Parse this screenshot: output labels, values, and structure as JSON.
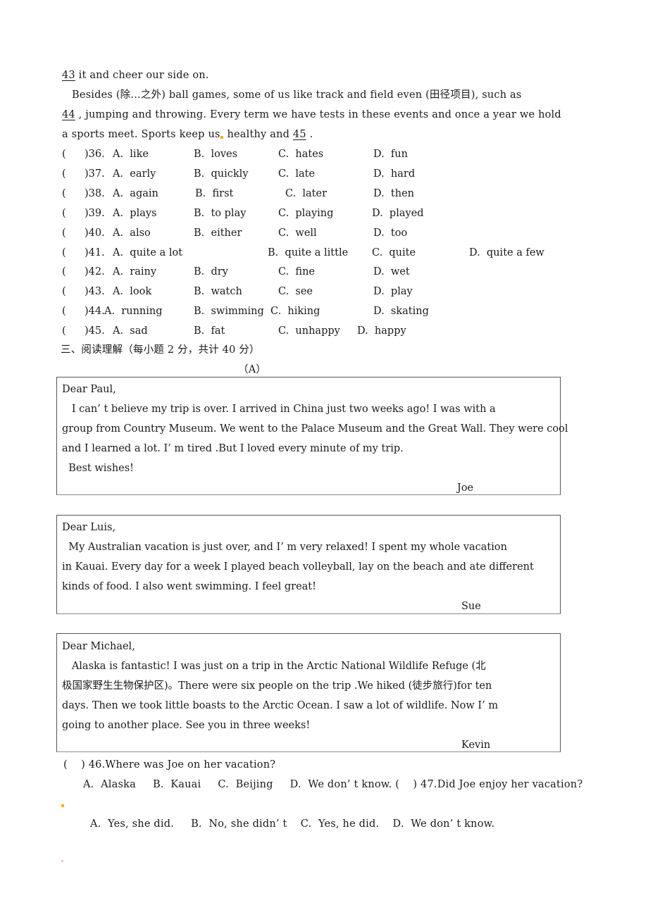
{
  "passage": {
    "line1": {
      "blank": "43",
      "text": " it and cheer our side on."
    },
    "line2": "Besides (除...之外) ball games, some of us like track and field even (田径项目), such as",
    "line3": {
      "blank": "44",
      "text": " , jumping and throwing. Every term we have tests in these events and once a year we hold"
    },
    "line4": {
      "before": "a sports meet. Sports keep us",
      "after": " healthy and ",
      "blank": "45",
      "end": " ."
    }
  },
  "cloze_questions": [
    {
      "num": ")36.",
      "A": "A.  like",
      "B": "B.  loves",
      "C": "C.  hates",
      "D": "D.  fun"
    },
    {
      "num": ")37.",
      "A": "A.  early",
      "B": "B.  quickly",
      "C": "C.  late",
      "D": "D.  hard"
    },
    {
      "num": ")38.",
      "A": "A.  again",
      "B": "B.  first",
      "C": "C.  later",
      "D": "D.  then"
    },
    {
      "num": ")39.",
      "A": "A.  plays",
      "B": "B.  to play",
      "C": "C.  playing",
      "D": "D.  played"
    },
    {
      "num": ")40.",
      "A": "A.  also",
      "B": "B.  either",
      "C": "C.  well",
      "D": "D.  too"
    },
    {
      "num": ")41.",
      "A": "A.  quite a lot",
      "B": "B.  quite a little",
      "C": "C.  quite",
      "D": "D.  quite a few"
    },
    {
      "num": ")42.",
      "A": "A.  rainy",
      "B": "B.  dry",
      "C": "C.  fine",
      "D": "D.  wet"
    },
    {
      "num": ")43.",
      "A": "A.  look",
      "B": "B.  watch",
      "C": "C.  see",
      "D": "D.  play"
    },
    {
      "num": ")44.",
      "A": "A.  running",
      "B": "B.  swimming",
      "C": "C.  hiking",
      "D": "D.  skating"
    },
    {
      "num": ")45.",
      "A": "A.  sad",
      "B": "B.  fat",
      "C": "C.  unhappy",
      "D": "D.  happy"
    }
  ],
  "paren_open": "(",
  "section_heading": "三、阅读理解（每小题 2 分，共计 40 分）",
  "passage_label": "（A）",
  "letters": [
    {
      "greeting": "Dear Paul,",
      "lines": [
        "   I can’ t believe my trip is over. I arrived in China just two weeks ago! I was with a",
        "group from Country Museum. We went to the Palace Museum and the Great Wall. They were cool",
        "and I learned a lot. I’ m tired .But I loved every minute of my trip.",
        "  Best wishes!"
      ],
      "signature": "Joe"
    },
    {
      "greeting": "Dear Luis,",
      "lines": [
        "  My Australian vacation is just over, and I’ m very relaxed! I spent my whole vacation",
        "in Kauai. Every day for a week I played beach volleyball, lay on the beach and ate different",
        "kinds of food. I also went swimming. I feel great!"
      ],
      "signature": "Sue"
    },
    {
      "greeting": "Dear Michael,",
      "lines": [
        "   Alaska is fantastic! I was just on a trip in the Arctic National Wildlife Refuge (北",
        "极国家野生生物保护区)。There were six people on the trip .We hiked (徒步旅行)for ten",
        "days. Then we took little boasts to the Arctic Ocean. I saw a lot of wildlife. Now I’ m",
        "going to another place. See you in three weeks!"
      ],
      "signature": "Kevin"
    }
  ],
  "reading_questions": {
    "q46": "(    ) 46.Where was Joe on her vacation?",
    "q46_options": "A.  Alaska     B.  Kauai     C.  Beijing     D.  We don’ t know. (    ) 47.Did Joe enjoy her vacation?",
    "q47_options": "A.  Yes, she did.     B.  No, she didn’ t    C.  Yes, he did.    D.  We don’ t know."
  }
}
